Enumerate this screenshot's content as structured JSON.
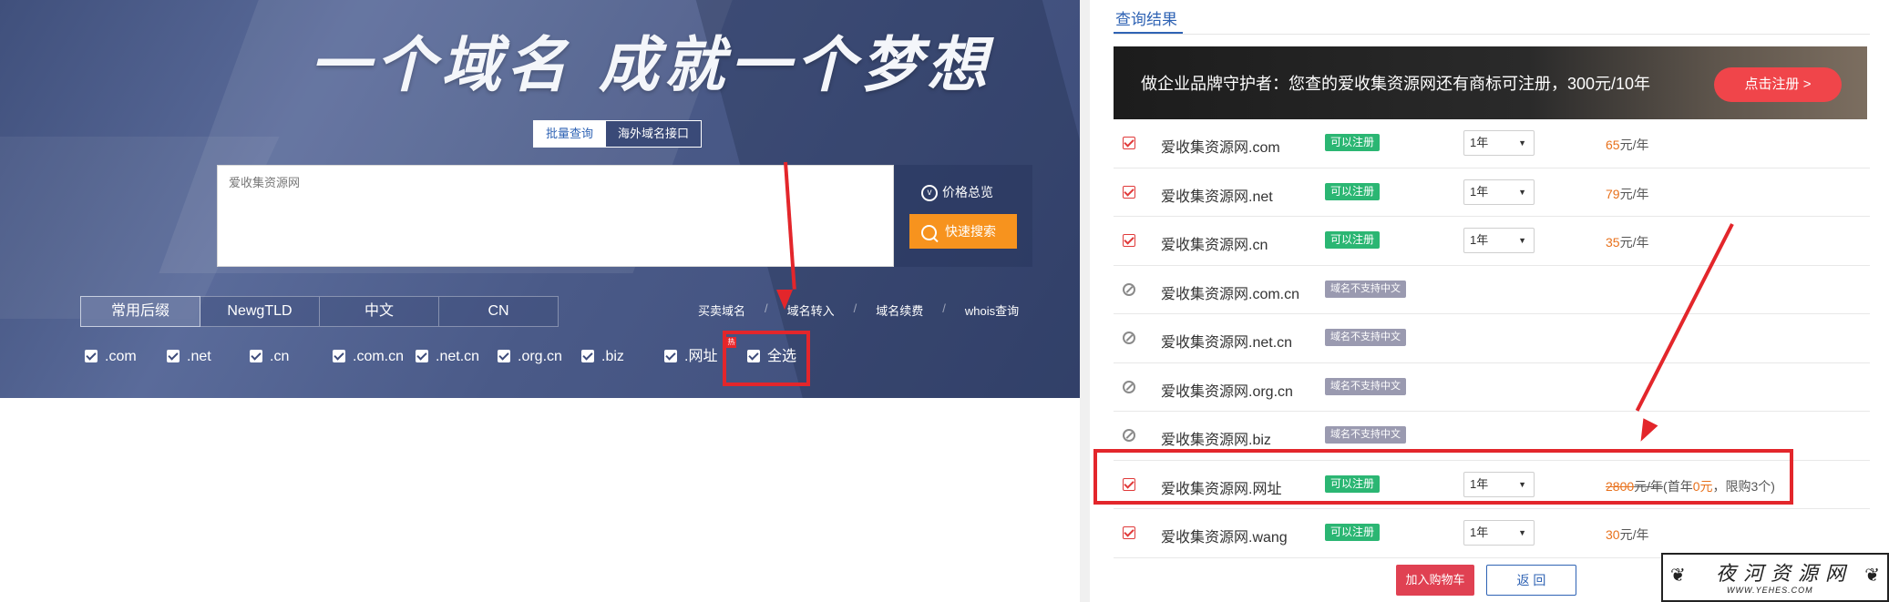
{
  "hero": {
    "slogan": "一个域名 成就一个梦想",
    "mode_tabs": [
      "批量查询",
      "海外域名接口"
    ],
    "search_value": "爱收集资源网",
    "price_overview": "价格总览",
    "quick_search": "快速搜索",
    "category_tabs": [
      "常用后缀",
      "NewgTLD",
      "中文",
      "CN"
    ],
    "side_links": [
      "买卖域名",
      "域名转入",
      "域名续费",
      "whois查询"
    ],
    "suffixes": [
      ".com",
      ".net",
      ".cn",
      ".com.cn",
      ".net.cn",
      ".org.cn",
      ".biz",
      ".网址",
      "全选"
    ],
    "hot_badge": "热"
  },
  "results": {
    "title": "查询结果",
    "promo_text": "做企业品牌守护者：您查的爱收集资源网还有商标可注册，300元/10年",
    "promo_button": "点击注册 >",
    "rows": [
      {
        "domain": "爱收集资源网.com",
        "status": "可以注册",
        "available": true,
        "year": "1年",
        "price": "65",
        "unit": "元/年"
      },
      {
        "domain": "爱收集资源网.net",
        "status": "可以注册",
        "available": true,
        "year": "1年",
        "price": "79",
        "unit": "元/年"
      },
      {
        "domain": "爱收集资源网.cn",
        "status": "可以注册",
        "available": true,
        "year": "1年",
        "price": "35",
        "unit": "元/年"
      },
      {
        "domain": "爱收集资源网.com.cn",
        "status": "域名不支持中文",
        "available": false
      },
      {
        "domain": "爱收集资源网.net.cn",
        "status": "域名不支持中文",
        "available": false
      },
      {
        "domain": "爱收集资源网.org.cn",
        "status": "域名不支持中文",
        "available": false
      },
      {
        "domain": "爱收集资源网.biz",
        "status": "域名不支持中文",
        "available": false
      },
      {
        "domain": "爱收集资源网.网址",
        "status": "可以注册",
        "available": true,
        "year": "1年",
        "price": "2800",
        "unit": "元/年",
        "note_a": "(首年",
        "note_price": "0元",
        "note_b": "，限购3个)"
      },
      {
        "domain": "爱收集资源网.wang",
        "status": "可以注册",
        "available": true,
        "year": "1年",
        "price": "30",
        "unit": "元/年"
      }
    ],
    "add_to_cart": "加入购物车",
    "back": "返 回"
  },
  "watermark": {
    "cn": "夜河资源网",
    "en": "WWW.YEHES.COM"
  },
  "colors": {
    "accent_blue": "#2f63b4",
    "orange": "#f7931e",
    "annotation_red": "#e3262b",
    "available_green": "#2bb673"
  }
}
